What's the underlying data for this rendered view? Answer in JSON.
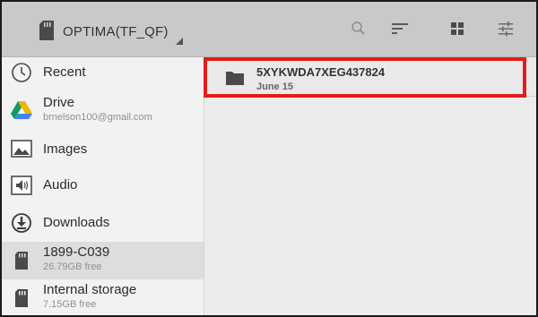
{
  "app_bar": {
    "root_title": "OPTIMA(TF_QF)",
    "root_icon": "sd-card-icon",
    "actions": [
      "search-icon",
      "sort-icon",
      "grid-view-icon",
      "settings-tune-icon"
    ],
    "background": "#c9c9c9"
  },
  "sidebar": {
    "items": [
      {
        "label": "Recent",
        "subtitle": "",
        "icon": "clock-icon"
      },
      {
        "label": "Drive",
        "subtitle": "brnelson100@gmail.com",
        "icon": "google-drive-icon"
      },
      {
        "label": "Images",
        "subtitle": "",
        "icon": "image-icon"
      },
      {
        "label": "Audio",
        "subtitle": "",
        "icon": "audio-icon"
      },
      {
        "label": "Downloads",
        "subtitle": "",
        "icon": "download-icon"
      },
      {
        "label": "1899-C039",
        "subtitle": "26.79GB free",
        "icon": "sd-card-icon",
        "selected": true
      },
      {
        "label": "Internal storage",
        "subtitle": "7.15GB free",
        "icon": "sd-card-icon"
      }
    ]
  },
  "content": {
    "documents": [
      {
        "name": "5XYKWDA7XEG437824",
        "date": "June 15",
        "icon": "folder-icon"
      }
    ],
    "highlight_color": "#e41b1b"
  }
}
